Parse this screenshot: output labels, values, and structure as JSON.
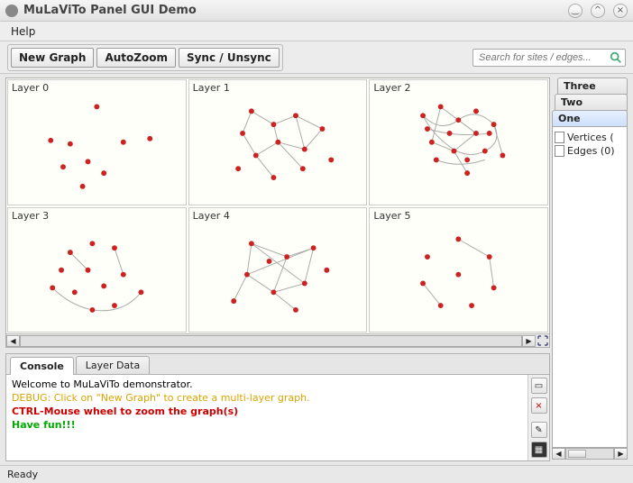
{
  "window": {
    "title": "MuLaViTo Panel GUI Demo"
  },
  "menubar": {
    "help": "Help"
  },
  "toolbar": {
    "new_graph": "New Graph",
    "autozoom": "AutoZoom",
    "sync": "Sync / Unsync"
  },
  "search": {
    "placeholder": "Search for sites / edges..."
  },
  "layers": [
    {
      "name": "Layer 0"
    },
    {
      "name": "Layer 1"
    },
    {
      "name": "Layer 2"
    },
    {
      "name": "Layer 3"
    },
    {
      "name": "Layer 4"
    },
    {
      "name": "Layer 5"
    }
  ],
  "bottom_tabs": {
    "console": "Console",
    "layer_data": "Layer Data"
  },
  "console": {
    "lines": [
      {
        "text": "Welcome to MuLaViTo demonstrator.",
        "cls": "l0"
      },
      {
        "text": "DEBUG: Click on \"New Graph\" to create a multi-layer graph.",
        "cls": "l1"
      },
      {
        "text": "CTRL-Mouse wheel to zoom the graph(s)",
        "cls": "l2"
      },
      {
        "text": "Have fun!!!",
        "cls": "l3"
      }
    ]
  },
  "right_tabs": {
    "three": "Three",
    "two": "Two",
    "one": "One"
  },
  "tree": {
    "vertices": "Vertices (",
    "edges": "Edges (0)"
  },
  "status": {
    "ready": "Ready"
  }
}
